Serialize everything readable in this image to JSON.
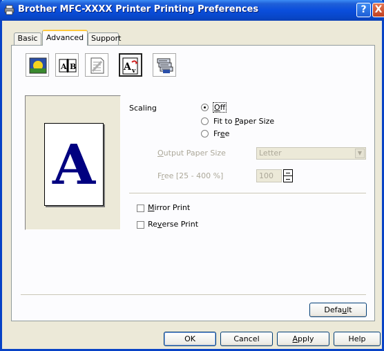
{
  "window": {
    "title": "Brother MFC-XXXX Printer Printing Preferences",
    "help_label": "?",
    "close_label": "X"
  },
  "tabs": [
    {
      "label": "Basic"
    },
    {
      "label": "Advanced",
      "active": true
    },
    {
      "label": "Support"
    }
  ],
  "toolbar": [
    {
      "name": "quality-icon"
    },
    {
      "name": "duplex-icon"
    },
    {
      "name": "watermark-icon"
    },
    {
      "name": "page-setting-icon",
      "selected": true
    },
    {
      "name": "device-options-icon"
    }
  ],
  "preview": {
    "letter": "A"
  },
  "scaling": {
    "label": "Scaling",
    "options": [
      {
        "label": "Off",
        "selected": true
      },
      {
        "label": "Fit to Paper Size",
        "selected": false
      },
      {
        "label": "Free",
        "selected": false
      }
    ]
  },
  "output_paper_size": {
    "label": "Output Paper Size",
    "value": "Letter"
  },
  "free_scale": {
    "label": "Free [25 - 400 %]",
    "value": "100"
  },
  "checkboxes": [
    {
      "label": "Mirror Print",
      "checked": false
    },
    {
      "label": "Reverse Print",
      "checked": false
    }
  ],
  "buttons": {
    "default": "Default",
    "ok": "OK",
    "cancel": "Cancel",
    "apply": "Apply",
    "help": "Help"
  },
  "colors": {
    "titlebar": "#0A4EDC",
    "dialog_bg": "#ECE9D8",
    "preview_letter": "#000080",
    "active_tab_accent": "#FFC83C"
  }
}
